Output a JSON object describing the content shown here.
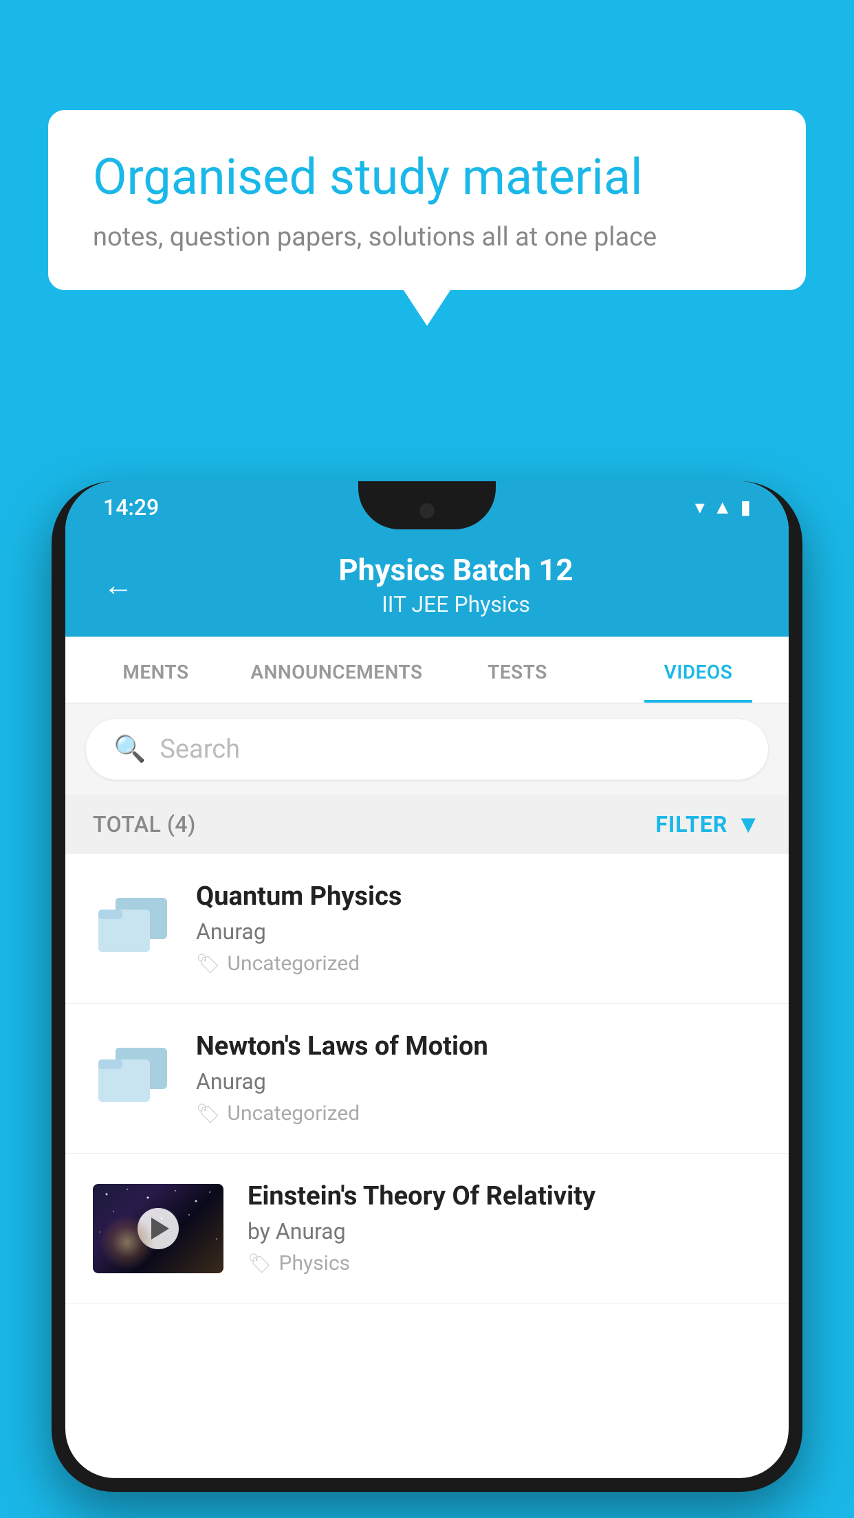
{
  "background_color": "#1ab8e8",
  "speech_bubble": {
    "title": "Organised study material",
    "subtitle": "notes, question papers, solutions all at one place"
  },
  "phone": {
    "status_bar": {
      "time": "14:29"
    },
    "header": {
      "back_label": "←",
      "title": "Physics Batch 12",
      "subtitle": "IIT JEE   Physics"
    },
    "tabs": [
      {
        "label": "MENTS",
        "active": false
      },
      {
        "label": "ANNOUNCEMENTS",
        "active": false
      },
      {
        "label": "TESTS",
        "active": false
      },
      {
        "label": "VIDEOS",
        "active": true
      }
    ],
    "search": {
      "placeholder": "Search"
    },
    "filter_bar": {
      "total_label": "TOTAL (4)",
      "filter_label": "FILTER"
    },
    "videos": [
      {
        "title": "Quantum Physics",
        "author": "Anurag",
        "tag": "Uncategorized",
        "has_thumbnail": false
      },
      {
        "title": "Newton's Laws of Motion",
        "author": "Anurag",
        "tag": "Uncategorized",
        "has_thumbnail": false
      },
      {
        "title": "Einstein's Theory Of Relativity",
        "author": "by Anurag",
        "tag": "Physics",
        "has_thumbnail": true
      }
    ]
  }
}
